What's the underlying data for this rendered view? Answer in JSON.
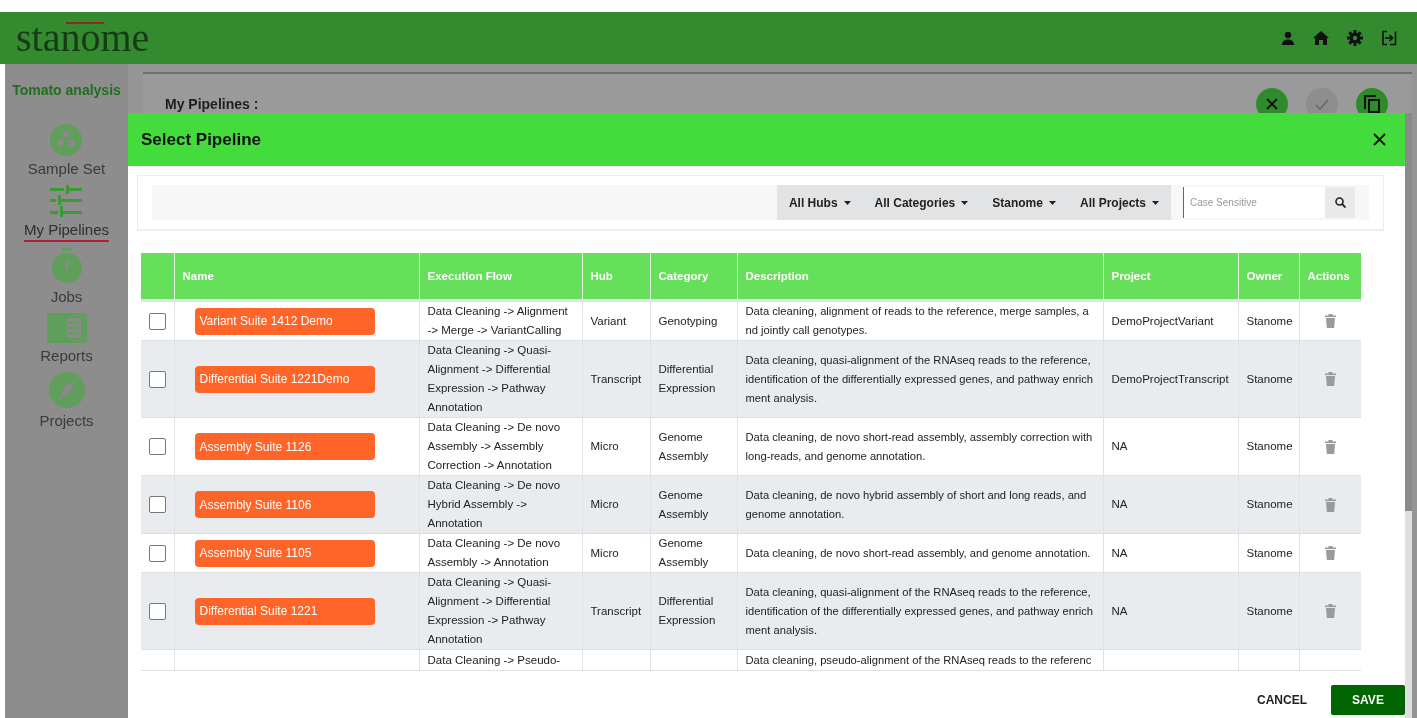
{
  "header": {
    "logo": "stanome"
  },
  "sidebar": {
    "project": "Tomato analysis",
    "items": [
      {
        "label": "Sample Set",
        "selected": false
      },
      {
        "label": "My Pipelines",
        "selected": true
      },
      {
        "label": "Jobs",
        "selected": false
      },
      {
        "label": "Reports",
        "selected": false
      },
      {
        "label": "Projects",
        "selected": false
      }
    ]
  },
  "page": {
    "title": "My Pipelines :",
    "actions": [
      {
        "disabled": false
      },
      {
        "disabled": true
      },
      {
        "disabled": false
      }
    ]
  },
  "modal": {
    "title": "Select Pipeline",
    "filters": [
      "All Hubs",
      "All Categories",
      "Stanome",
      "All Projects"
    ],
    "search": {
      "placeholder": "Case Sensitive"
    },
    "columns": [
      "Name",
      "Execution Flow",
      "Hub",
      "Category",
      "Description",
      "Project",
      "Owner",
      "Actions"
    ],
    "rows": [
      {
        "checked": false,
        "name": "Variant Suite 1412 Demo",
        "flow": "Data Cleaning -> Alignment -> Merge -> VariantCalling",
        "hub": "Variant",
        "category": "Genotyping",
        "description": "Data cleaning, alignment of reads to the reference, merge samples, and jointly call genotypes.",
        "project": "DemoProjectVariant",
        "owner": "Stanome"
      },
      {
        "checked": false,
        "name": "Differential Suite 1221Demo",
        "flow": "Data Cleaning -> Quasi-Alignment -> Differential Expression -> Pathway Annotation",
        "hub": "Transcript",
        "category": "Differential Expression",
        "description": "Data cleaning, quasi-alignment of the RNAseq reads to the reference, identification of the differentially expressed genes, and pathway enrichment analysis.",
        "project": "DemoProjectTranscript",
        "owner": "Stanome"
      },
      {
        "checked": false,
        "name": "Assembly Suite 1126",
        "flow": "Data Cleaning -> De novo Assembly -> Assembly Correction -> Annotation",
        "hub": "Micro",
        "category": "Genome Assembly",
        "description": "Data cleaning, de novo short-read assembly, assembly correction with long-reads, and genome annotation.",
        "project": "NA",
        "owner": "Stanome"
      },
      {
        "checked": false,
        "name": "Assembly Suite 1106",
        "flow": "Data Cleaning -> De novo Hybrid Assembly -> Annotation",
        "hub": "Micro",
        "category": "Genome Assembly",
        "description": "Data cleaning, de novo hybrid assembly of short and long reads, and genome annotation.",
        "project": "NA",
        "owner": "Stanome"
      },
      {
        "checked": false,
        "name": "Assembly Suite 1105",
        "flow": "Data Cleaning -> De novo Assembly -> Annotation",
        "hub": "Micro",
        "category": "Genome Assembly",
        "description": "Data cleaning, de novo short-read assembly, and genome annotation.",
        "project": "NA",
        "owner": "Stanome"
      },
      {
        "checked": false,
        "name": "Differential Suite 1221",
        "flow": "Data Cleaning -> Quasi-Alignment -> Differential Expression -> Pathway Annotation",
        "hub": "Transcript",
        "category": "Differential Expression",
        "description": "Data cleaning, quasi-alignment of the RNAseq reads to the reference, identification of the differentially expressed genes, and pathway enrichment analysis.",
        "project": "NA",
        "owner": "Stanome"
      },
      {
        "flow": "Data Cleaning -> Pseudo-",
        "description": "Data cleaning, pseudo-alignment of the RNAseq reads to the referenc"
      }
    ],
    "buttons": [
      "CANCEL",
      "SAVE"
    ]
  }
}
